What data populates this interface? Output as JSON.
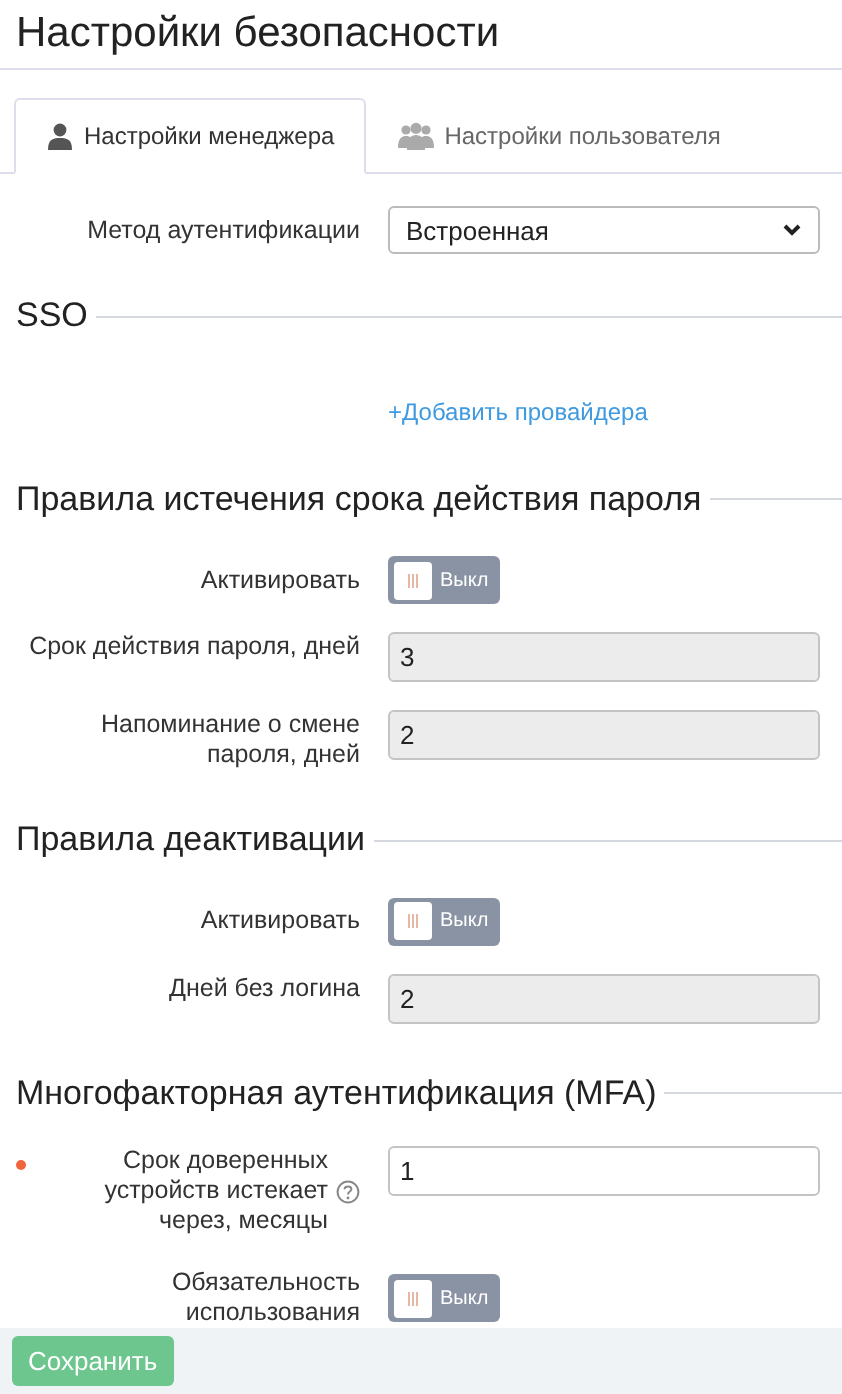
{
  "title": "Настройки безопасности",
  "tabs": [
    {
      "label": "Настройки менеджера",
      "selected": true
    },
    {
      "label": "Настройки пользователя",
      "selected": false
    }
  ],
  "sections": [
    {
      "rows": [
        {
          "kind": "select",
          "label": "Метод аутентификации",
          "value": "Встроенная"
        }
      ]
    },
    {
      "heading": "SSO",
      "rows": [
        {
          "kind": "link",
          "text": "+Добавить провайдера"
        }
      ]
    },
    {
      "heading": "Правила истечения срока действия пароля",
      "rows": [
        {
          "kind": "toggle",
          "label": "Активировать",
          "on": false,
          "state_label": "Выкл"
        },
        {
          "kind": "field",
          "label": "Срок действия пароля, дней",
          "value": "3",
          "disabled": true
        },
        {
          "kind": "field",
          "label": "Напоминание о смене пароля, дней",
          "value": "2",
          "disabled": true
        }
      ]
    },
    {
      "heading": "Правила деактивации",
      "rows": [
        {
          "kind": "toggle",
          "label": "Активировать",
          "on": false,
          "state_label": "Выкл"
        },
        {
          "kind": "field",
          "label": "Дней без логина",
          "value": "2",
          "disabled": true
        }
      ]
    },
    {
      "heading": "Многофакторная аутентификация (MFA)",
      "rows": [
        {
          "kind": "field",
          "label": "Срок доверенных устройств истекает через, месяцы",
          "value": "1",
          "disabled": false,
          "required": true,
          "help": true
        },
        {
          "kind": "toggle",
          "label": "Обязательность использования",
          "on": false,
          "state_label": "Выкл"
        }
      ]
    }
  ],
  "save_button": "Сохранить"
}
